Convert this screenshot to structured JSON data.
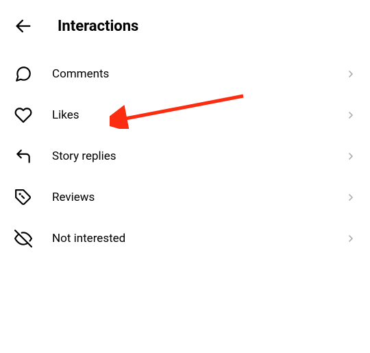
{
  "header": {
    "title": "Interactions"
  },
  "items": [
    {
      "label": "Comments"
    },
    {
      "label": "Likes"
    },
    {
      "label": "Story replies"
    },
    {
      "label": "Reviews"
    },
    {
      "label": "Not interested"
    }
  ],
  "annotation": {
    "target_index": 1,
    "color": "#fb2c10"
  }
}
